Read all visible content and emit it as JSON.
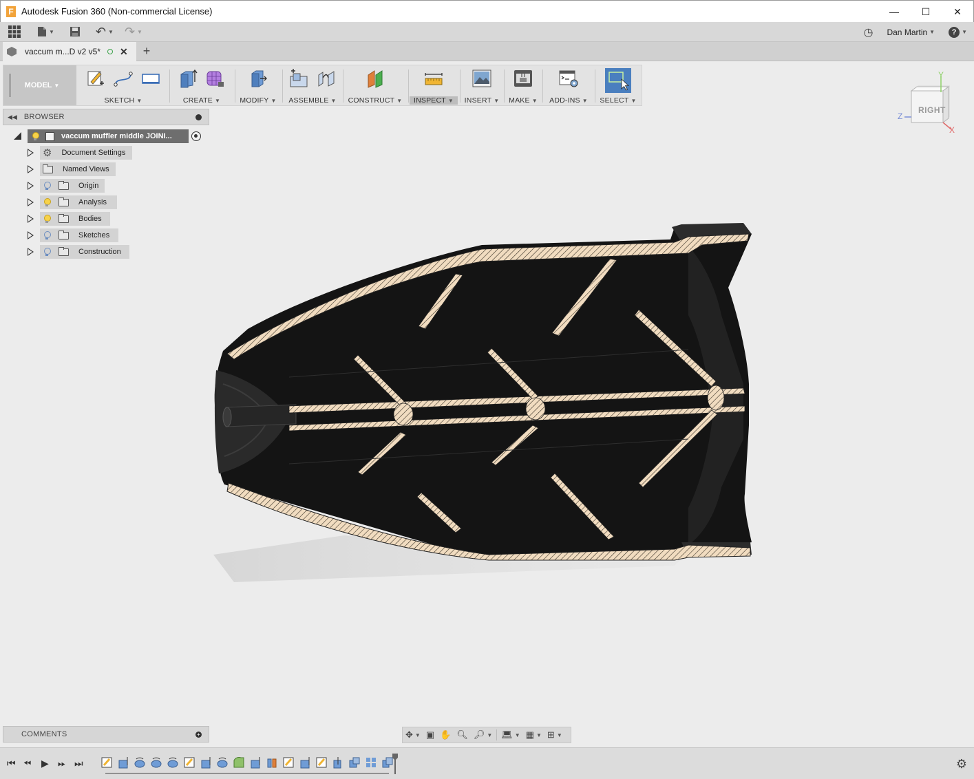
{
  "window": {
    "app_icon": "F",
    "title": "Autodesk Fusion 360 (Non-commercial License)",
    "controls": [
      "minimize-icon",
      "maximize-icon",
      "close-icon"
    ]
  },
  "quick_access": {
    "user_name": "Dan Martin",
    "icons": [
      "app-grid-icon",
      "file-icon",
      "save-icon",
      "undo-icon",
      "redo-icon",
      "job-status-icon",
      "help-icon"
    ]
  },
  "document_tab": {
    "name": "vaccum m...D v2 v5*",
    "new_tab": "+"
  },
  "ribbon": {
    "workspace": "MODEL",
    "panels": [
      {
        "label": "SKETCH",
        "icons": [
          "create-sketch-icon",
          "line-icon",
          "rectangle-icon"
        ]
      },
      {
        "label": "CREATE",
        "icons": [
          "extrude-icon",
          "form-icon"
        ]
      },
      {
        "label": "MODIFY",
        "icons": [
          "press-pull-icon"
        ]
      },
      {
        "label": "ASSEMBLE",
        "icons": [
          "new-component-icon",
          "joint-icon"
        ]
      },
      {
        "label": "CONSTRUCT",
        "icons": [
          "offset-plane-icon"
        ]
      },
      {
        "label": "INSPECT",
        "icons": [
          "measure-icon"
        ]
      },
      {
        "label": "INSERT",
        "icons": [
          "insert-image-icon"
        ]
      },
      {
        "label": "MAKE",
        "icons": [
          "3d-print-icon"
        ]
      },
      {
        "label": "ADD-INS",
        "icons": [
          "scripts-icon"
        ]
      },
      {
        "label": "SELECT",
        "icons": [
          "select-icon"
        ]
      }
    ],
    "active_panel": "INSPECT",
    "colors": {
      "select_accent": "#4a7fbf",
      "construct_green": "#4caf50",
      "construct_orange": "#e0803a"
    }
  },
  "browser": {
    "title": "BROWSER",
    "root": "vaccum muffler middle JOINI...",
    "items": [
      {
        "label": "Document Settings",
        "icon": "gear-icon"
      },
      {
        "label": "Named Views",
        "icon": "folder-icon"
      },
      {
        "label": "Origin",
        "icon": "folder-icon",
        "visible": false
      },
      {
        "label": "Analysis",
        "icon": "folder-icon",
        "visible": true
      },
      {
        "label": "Bodies",
        "icon": "folder-icon",
        "visible": true
      },
      {
        "label": "Sketches",
        "icon": "folder-icon",
        "visible": false
      },
      {
        "label": "Construction",
        "icon": "folder-icon",
        "visible": false
      }
    ]
  },
  "viewcube": {
    "face": "RIGHT",
    "axes": {
      "x": "X",
      "y": "Y",
      "z": "Z"
    }
  },
  "comments": {
    "title": "COMMENTS"
  },
  "navbar": {
    "icons": [
      "orbit-icon",
      "look-at-icon",
      "pan-icon",
      "zoom-icon",
      "fit-icon",
      "display-settings-icon",
      "grid-icon",
      "viewports-icon"
    ]
  },
  "timeline": {
    "controls": [
      "first-icon",
      "previous-icon",
      "play-icon",
      "next-icon",
      "last-icon"
    ],
    "features": [
      "sketch",
      "extrude",
      "revolve",
      "revolve",
      "revolve",
      "sketch",
      "extrude",
      "revolve",
      "fillet",
      "extrude",
      "split",
      "sketch",
      "extrude",
      "sketch",
      "press",
      "move",
      "pattern",
      "combine"
    ],
    "settings_icon": "gear-icon"
  }
}
